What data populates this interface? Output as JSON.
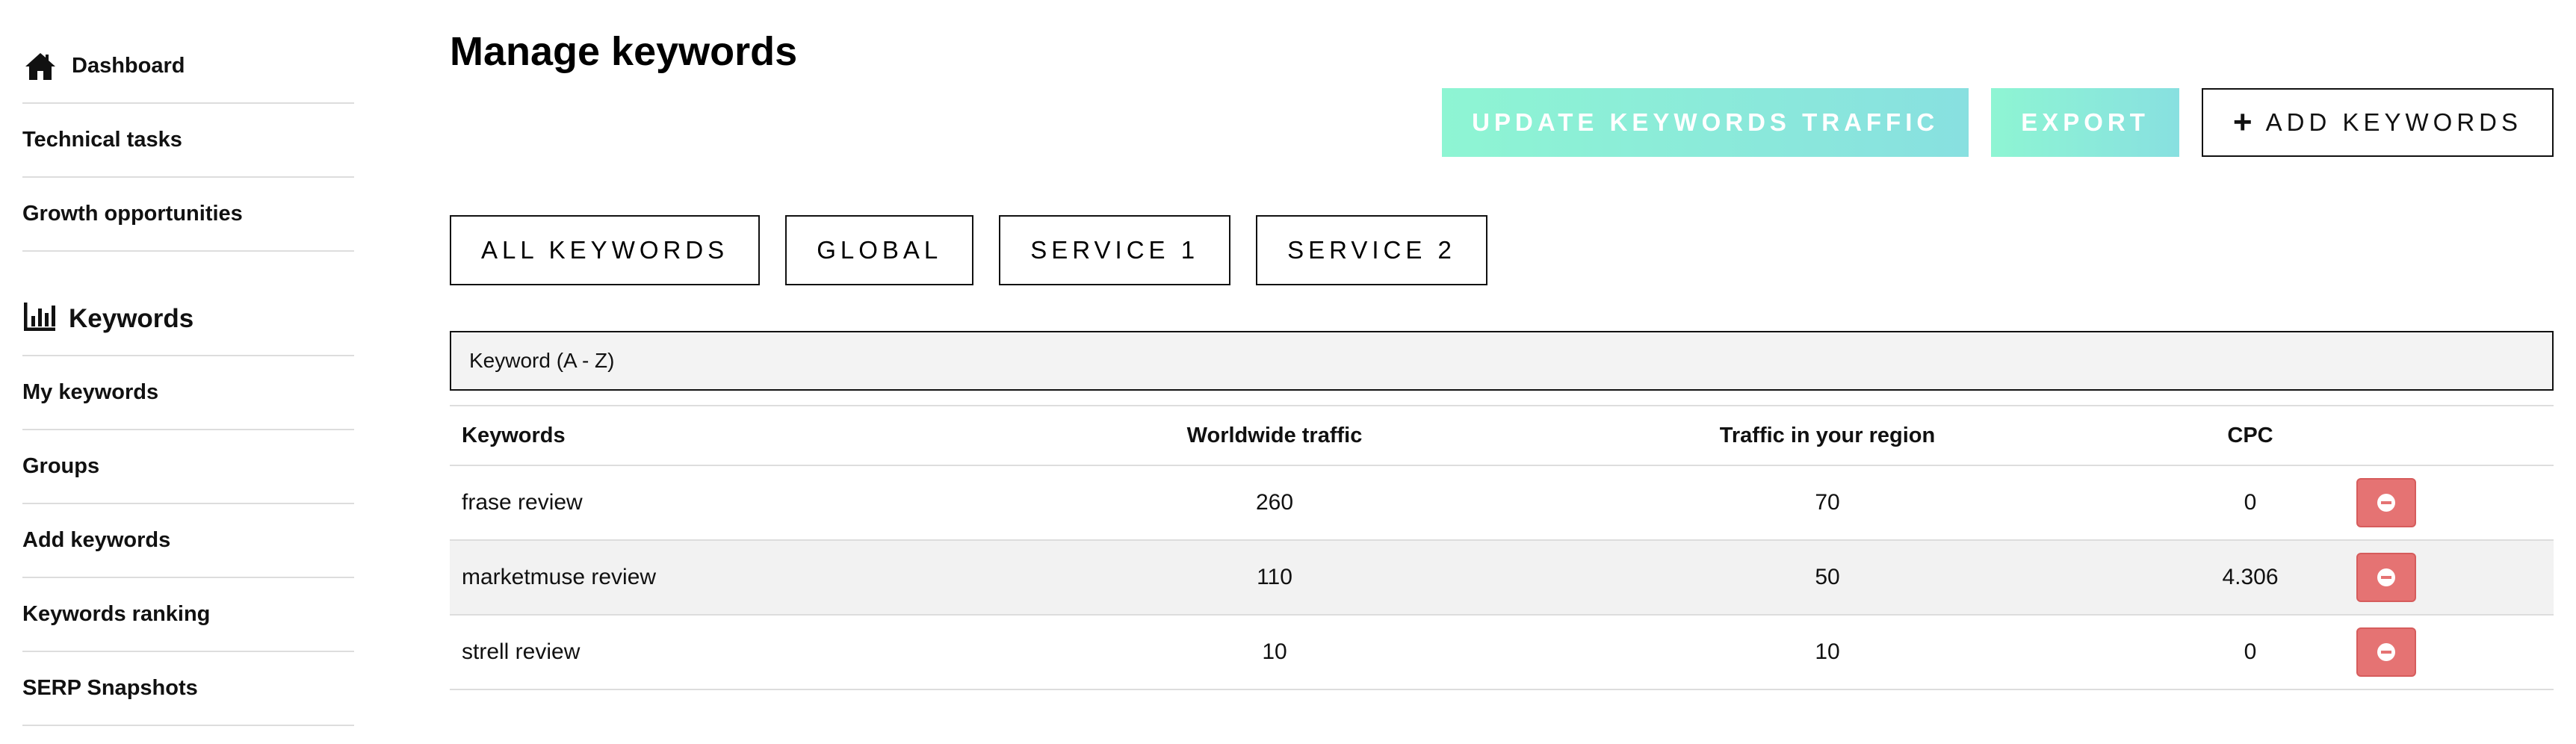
{
  "sidebar": {
    "items_top": [
      {
        "label": "Dashboard",
        "icon": "home-icon"
      },
      {
        "label": "Technical tasks"
      },
      {
        "label": "Growth opportunities"
      }
    ],
    "section": {
      "label": "Keywords",
      "icon": "bar-chart-icon"
    },
    "items_keywords": [
      {
        "label": "My keywords"
      },
      {
        "label": "Groups"
      },
      {
        "label": "Add keywords"
      },
      {
        "label": "Keywords ranking"
      },
      {
        "label": "SERP Snapshots"
      }
    ]
  },
  "main": {
    "title": "Manage keywords",
    "actions": {
      "update_label": "UPDATE KEYWORDS TRAFFIC",
      "export_label": "EXPORT",
      "add_label": "ADD KEYWORDS"
    },
    "filters": [
      "ALL KEYWORDS",
      "GLOBAL",
      "SERVICE 1",
      "SERVICE 2"
    ],
    "sort": {
      "selected": "Keyword (A - Z)"
    },
    "table": {
      "headers": [
        "Keywords",
        "Worldwide traffic",
        "Traffic in your region",
        "CPC"
      ],
      "rows": [
        {
          "keyword": "frase review",
          "worldwide": "260",
          "region": "70",
          "cpc": "0"
        },
        {
          "keyword": "marketmuse review",
          "worldwide": "110",
          "region": "50",
          "cpc": "4.306"
        },
        {
          "keyword": "strell review",
          "worldwide": "10",
          "region": "10",
          "cpc": "0"
        }
      ]
    }
  },
  "colors": {
    "accent_gradient_start": "#8ef5d3",
    "accent_gradient_end": "#88e0e0",
    "delete_red": "#e57373"
  }
}
